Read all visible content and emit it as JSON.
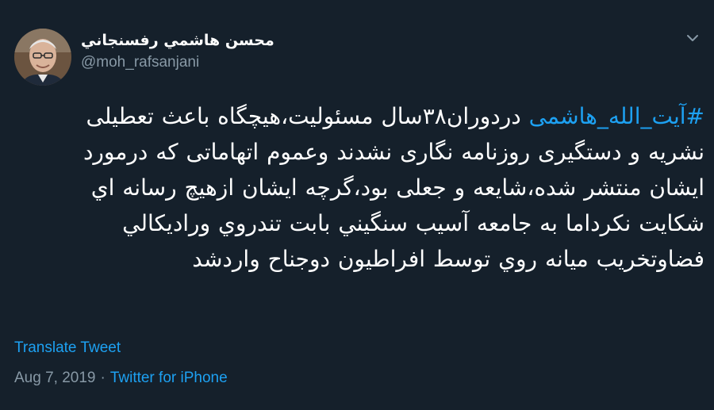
{
  "author": {
    "display_name": "محسن هاشمي رفسنجاني",
    "handle": "@moh_rafsanjani"
  },
  "tweet": {
    "hashtag": "#آیت_الله_هاشمی",
    "text_after_hashtag": " دردوران۳۸سال مسئولیت،هیچگاه باعث تعطیلی نشریه و دستگیری روزنامه نگاری نشدند وعموم اتهاماتی که درمورد ایشان منتشر شده،شایعه و جعلی بود،گرچه ایشان ازهیچ رسانه اي شکایت نکرداما به جامعه آسیب سنگيني بابت تندروي ورادیکالي فضاوتخریب میانه روي توسط افراطیون دوجناح واردشد"
  },
  "translate_label": "Translate Tweet",
  "meta": {
    "date": "Aug 7, 2019",
    "separator": "·",
    "source": "Twitter for iPhone"
  },
  "colors": {
    "background": "#15202b",
    "link": "#1da1f2",
    "secondary_text": "#8899a6",
    "primary_text": "#ffffff"
  },
  "icons": {
    "menu": "chevron-down-icon"
  }
}
